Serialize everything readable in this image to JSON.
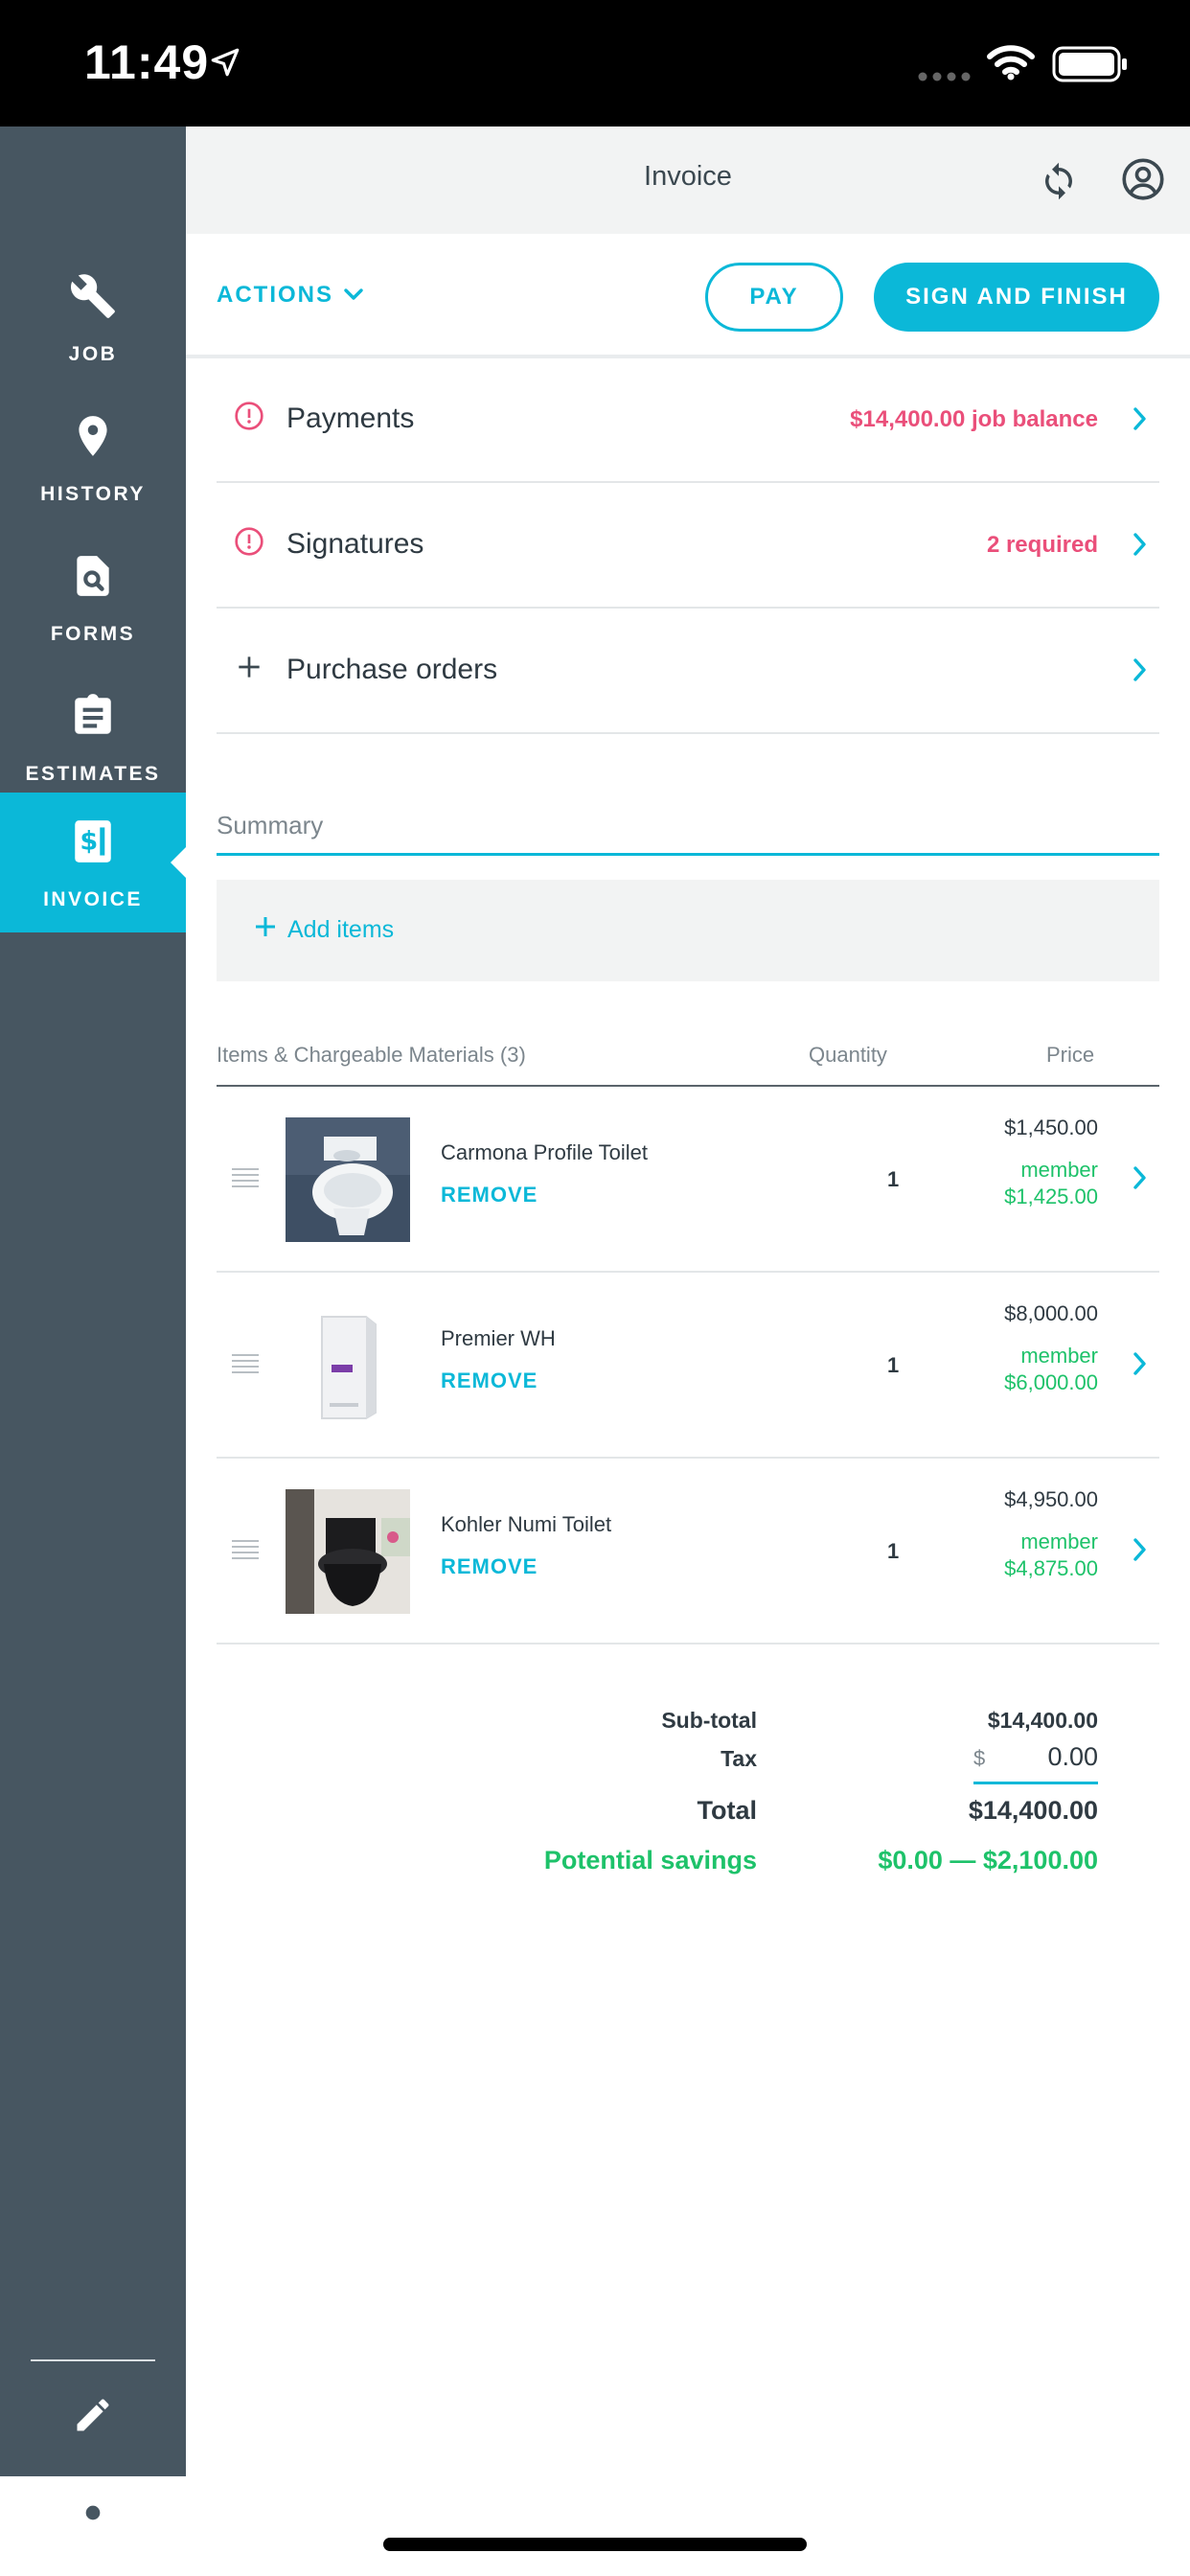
{
  "status_bar": {
    "time": "11:49"
  },
  "header": {
    "title": "Invoice"
  },
  "sidebar": {
    "items": [
      {
        "label": "JOB",
        "icon": "wrench-icon"
      },
      {
        "label": "HISTORY",
        "icon": "map-pin-icon"
      },
      {
        "label": "FORMS",
        "icon": "document-search-icon"
      },
      {
        "label": "ESTIMATES",
        "icon": "clipboard-icon"
      },
      {
        "label": "INVOICE",
        "icon": "invoice-dollar-icon",
        "active": true
      }
    ],
    "tools": [
      {
        "icon": "pencil-icon"
      },
      {
        "icon": "camera-icon"
      }
    ]
  },
  "action_bar": {
    "actions_label": "ACTIONS",
    "pay_label": "PAY",
    "finish_label": "SIGN AND FINISH"
  },
  "sections": [
    {
      "name": "Payments",
      "status": "$14,400.00 job balance",
      "lead_icon": "alert-circle-icon"
    },
    {
      "name": "Signatures",
      "status": "2 required",
      "lead_icon": "alert-circle-icon"
    },
    {
      "name": "Purchase orders",
      "status": "",
      "lead_icon": "plus-icon"
    }
  ],
  "summary": {
    "label": "Summary",
    "add_items": "Add items",
    "columns": {
      "items": "Items & Chargeable Materials (3)",
      "quantity": "Quantity",
      "price": "Price"
    },
    "items": [
      {
        "name": "Carmona Profile Toilet",
        "remove": "REMOVE",
        "quantity": "1",
        "price": "$1,450.00",
        "member_label": "member",
        "member_price": "$1,425.00"
      },
      {
        "name": "Premier WH",
        "remove": "REMOVE",
        "quantity": "1",
        "price": "$8,000.00",
        "member_label": "member",
        "member_price": "$6,000.00"
      },
      {
        "name": "Kohler Numi Toilet",
        "remove": "REMOVE",
        "quantity": "1",
        "price": "$4,950.00",
        "member_label": "member",
        "member_price": "$4,875.00"
      }
    ]
  },
  "totals": {
    "subtotal_label": "Sub-total",
    "subtotal": "$14,400.00",
    "tax_label": "Tax",
    "tax_currency": "$",
    "tax_value": "0.00",
    "total_label": "Total",
    "total": "$14,400.00",
    "savings_label": "Potential savings",
    "savings": "$0.00 — $2,100.00"
  },
  "colors": {
    "accent": "#0bb8d8",
    "sidebar": "#475661",
    "alert": "#ea4f7a",
    "savings": "#1ec26a"
  }
}
